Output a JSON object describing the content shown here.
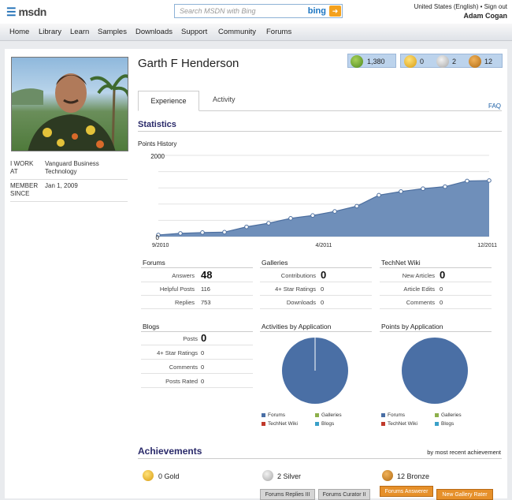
{
  "header": {
    "logo_text": "msdn",
    "search_placeholder": "Search MSDN with Bing",
    "search_brand": "bing",
    "locale": "United States (English)",
    "sign_out": "Sign out",
    "user": "Adam Cogan"
  },
  "nav": [
    "Home",
    "Library",
    "Learn",
    "Samples",
    "Downloads",
    "Support",
    "Community",
    "Forums"
  ],
  "profile": {
    "name": "Garth F Henderson",
    "work_label": "I WORK AT",
    "work_value": "Vanguard Business Technology",
    "member_label": "MEMBER SINCE",
    "member_value": "Jan 1, 2009",
    "points": "1,380",
    "gold": "0",
    "silver": "2",
    "bronze": "12"
  },
  "tabs": {
    "experience": "Experience",
    "activity": "Activity",
    "faq": "FAQ"
  },
  "statistics": {
    "title": "Statistics",
    "chart_label": "Points History",
    "ymax_label": "2000",
    "ymin_label": "0",
    "x_labels": [
      "9/2010",
      "4/2011",
      "12/2011"
    ]
  },
  "chart_data": {
    "type": "area",
    "title": "Points History",
    "x": [
      "9/2010",
      "10/2010",
      "11/2010",
      "12/2010",
      "1/2011",
      "2/2011",
      "3/2011",
      "4/2011",
      "5/2011",
      "6/2011",
      "7/2011",
      "8/2011",
      "9/2011",
      "10/2011",
      "11/2011",
      "12/2011"
    ],
    "values": [
      40,
      80,
      100,
      110,
      240,
      330,
      450,
      520,
      620,
      750,
      1020,
      1110,
      1180,
      1230,
      1370,
      1380
    ],
    "ylim": [
      0,
      2000
    ],
    "xlabel": "",
    "ylabel": "",
    "color": "#6f8fba"
  },
  "forums": {
    "title": "Forums",
    "rows": [
      {
        "label": "Answers",
        "value": "48"
      },
      {
        "label": "Helpful Posts",
        "value": "116"
      },
      {
        "label": "Replies",
        "value": "753"
      }
    ]
  },
  "galleries": {
    "title": "Galleries",
    "rows": [
      {
        "label": "Contributions",
        "value": "0"
      },
      {
        "label": "4+ Star Ratings",
        "value": "0"
      },
      {
        "label": "Downloads",
        "value": "0"
      }
    ]
  },
  "technet": {
    "title": "TechNet Wiki",
    "rows": [
      {
        "label": "New Articles",
        "value": "0"
      },
      {
        "label": "Article Edits",
        "value": "0"
      },
      {
        "label": "Comments",
        "value": "0"
      }
    ]
  },
  "blogs": {
    "title": "Blogs",
    "rows": [
      {
        "label": "Posts",
        "value": "0"
      },
      {
        "label": "4+ Star Ratings",
        "value": "0"
      },
      {
        "label": "Comments",
        "value": "0"
      },
      {
        "label": "Posts Rated",
        "value": "0"
      }
    ]
  },
  "activities_pie": {
    "title": "Activities by Application"
  },
  "points_pie": {
    "title": "Points by Application"
  },
  "legend": {
    "forums": "Forums",
    "galleries": "Galleries",
    "technet": "TechNet Wiki",
    "blogs": "Blogs"
  },
  "colors": {
    "forums": "#4a6fa5",
    "galleries": "#8db04b",
    "technet": "#c0392b",
    "blogs": "#3aa0c8",
    "heading": "#2a2a6a",
    "link": "#1a5ea5"
  },
  "achievements": {
    "title": "Achievements",
    "sort": "by most recent achievement",
    "gold": "0 Gold",
    "silver": "2 Silver",
    "bronze": "12 Bronze",
    "buttons": [
      "Forums Replies III",
      "Forums Curator II",
      "Forums Answerer",
      "New Gallery Rater"
    ]
  }
}
